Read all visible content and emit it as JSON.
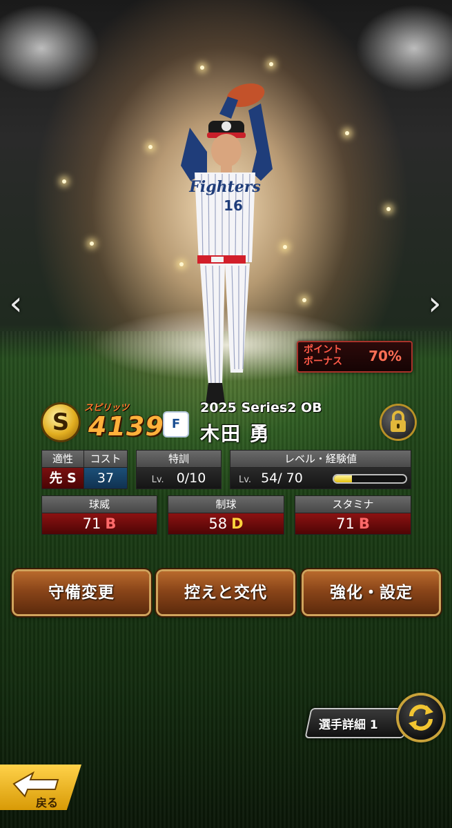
{
  "navigation": {
    "prev_glyph": "‹",
    "next_glyph": "›"
  },
  "point_bonus": {
    "label_line1": "ポイント",
    "label_line2": "ボーナス",
    "value": "70%"
  },
  "player": {
    "rank_badge": "S",
    "spirits_label": "スピリッツ",
    "spirits_value": "4139",
    "team_logo_text": "F",
    "series": "2025 Series2 OB",
    "name": "木田 勇",
    "uniform_number": "16",
    "uniform_text": "Fighters"
  },
  "stats": {
    "aptitude": {
      "header": "適性",
      "value": "先 S"
    },
    "cost": {
      "header": "コスト",
      "value": "37"
    },
    "training": {
      "header": "特訓",
      "lv_label": "Lv.",
      "value": "0/10"
    },
    "level": {
      "header": "レベル・経験値",
      "lv_label": "Lv.",
      "value": "54/ 70",
      "exp_fraction": 0.25
    },
    "velocity": {
      "header": "球威",
      "value": "71",
      "grade": "B"
    },
    "control": {
      "header": "制球",
      "value": "58",
      "grade": "D"
    },
    "stamina": {
      "header": "スタミナ",
      "value": "71",
      "grade": "B"
    }
  },
  "actions": {
    "defense_change": "守備変更",
    "bench_swap": "控えと交代",
    "enhance_settings": "強化・設定"
  },
  "detail": {
    "label": "選手詳細 1"
  },
  "back": {
    "label": "戻る"
  },
  "colors": {
    "grade_b": "#ff6a6a",
    "grade_d": "#ffd23c",
    "spirits": "#ffb13b",
    "button_border": "#d0a35c"
  }
}
